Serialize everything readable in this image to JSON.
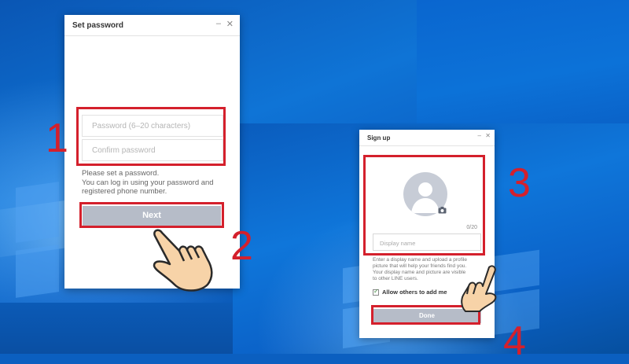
{
  "set_password_dialog": {
    "title": "Set password",
    "minimize": "–",
    "close": "✕",
    "password_placeholder": "Password (6–20 characters)",
    "confirm_placeholder": "Confirm password",
    "help_lines": [
      "Please set a password.",
      "You can log in using your password and",
      "registered phone number."
    ],
    "next_label": "Next"
  },
  "sign_up_dialog": {
    "title": "Sign up",
    "minimize": "–",
    "close": "✕",
    "char_counter": "0/20",
    "display_name_placeholder": "Display name",
    "help_lines": [
      "Enter a display name and upload a profile",
      "picture that will help your friends find you.",
      "Your display name and picture are visible",
      "to other LINE users."
    ],
    "allow_label": "Allow others to add me",
    "allow_checked": true,
    "done_label": "Done"
  },
  "annotations": {
    "steps": [
      "1",
      "2",
      "3",
      "4"
    ],
    "color": "#d4202c"
  },
  "colors": {
    "button_grey": "#b6bcc8",
    "desktop_blue": "#0b5fc0"
  }
}
